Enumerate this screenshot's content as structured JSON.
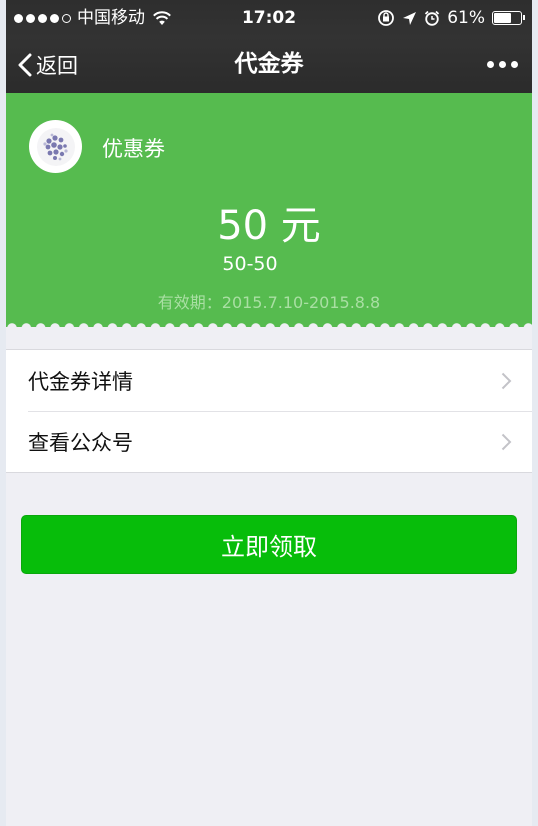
{
  "status_bar": {
    "carrier": "中国移动",
    "time": "17:02",
    "battery": "61%",
    "battery_level": 0.61
  },
  "nav": {
    "back_label": "返回",
    "title": "代金券"
  },
  "coupon": {
    "name": "优惠券",
    "amount": "50 元",
    "range": "50-50",
    "validity": "有效期：2015.7.10-2015.8.8",
    "background_color": "#56bb4f"
  },
  "menu": {
    "items": [
      {
        "label": "代金券详情"
      },
      {
        "label": "查看公众号"
      }
    ]
  },
  "cta": {
    "label": "立即领取",
    "color": "#07bd0a"
  }
}
